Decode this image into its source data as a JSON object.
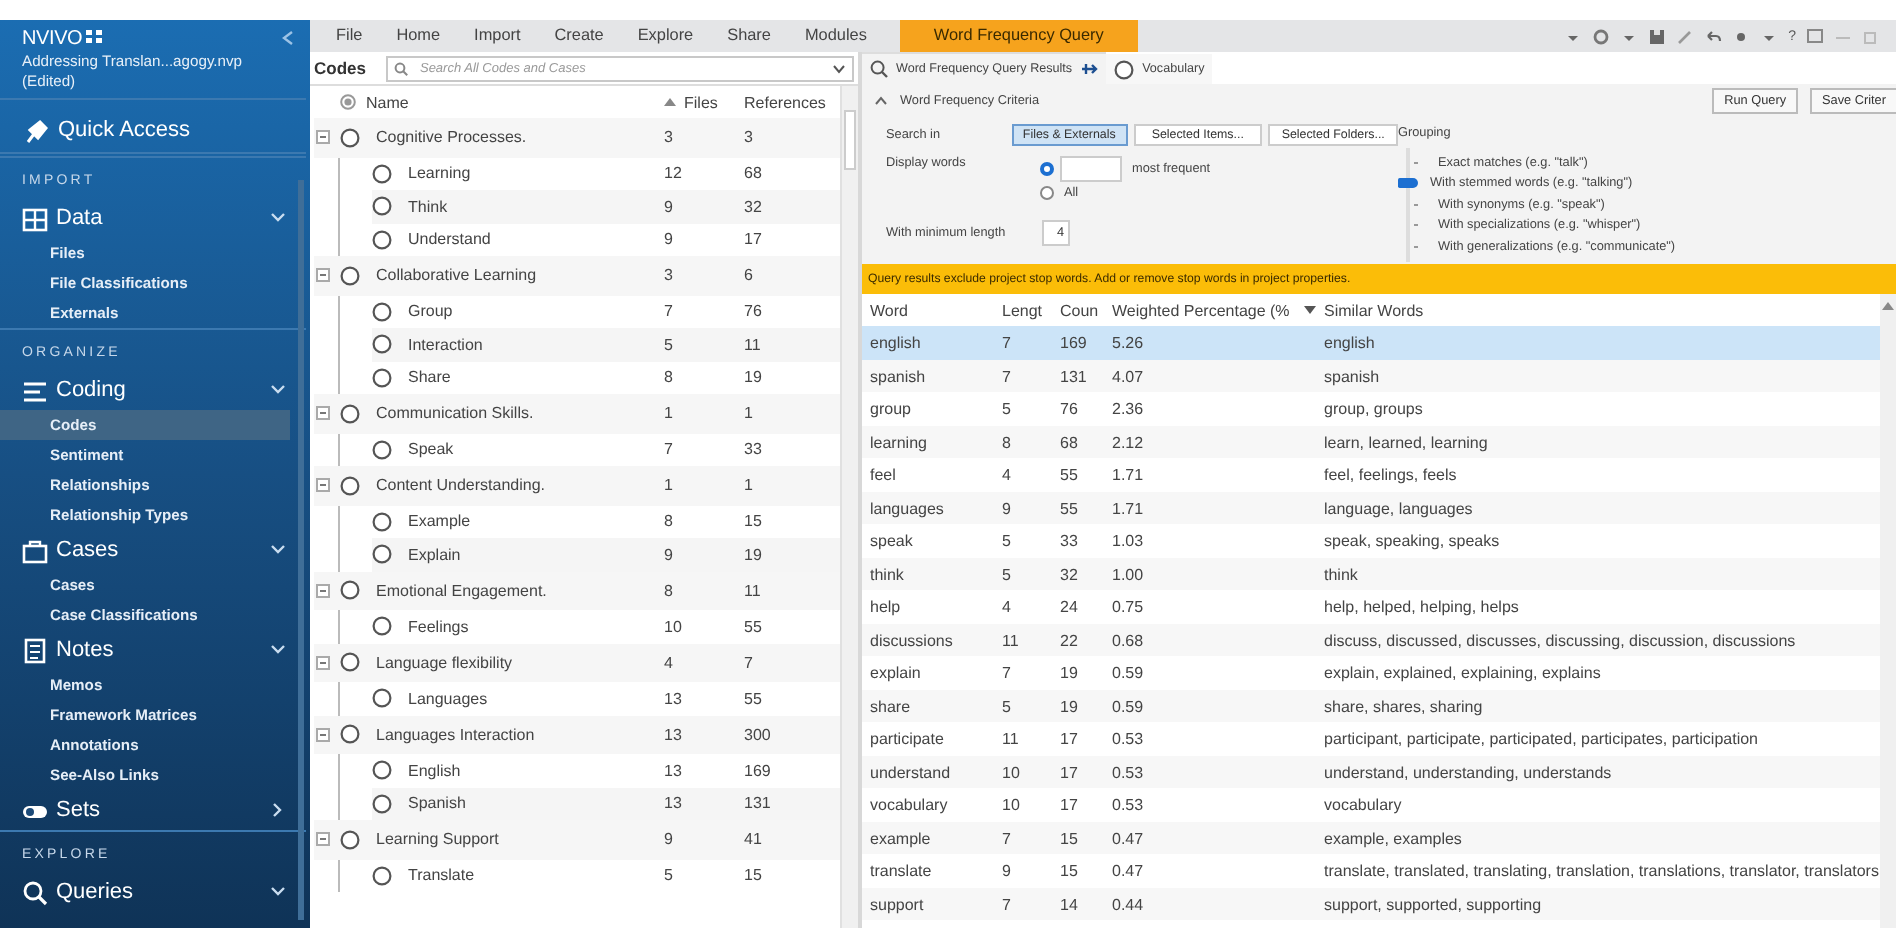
{
  "app": {
    "logo": "NVIVO",
    "project_file": "Addressing Translan...agogy.nvp",
    "project_state": "(Edited)"
  },
  "sidebar": [
    {
      "kind": "link",
      "label": "Quick Access"
    },
    {
      "kind": "heading",
      "label": "IMPORT"
    },
    {
      "kind": "group",
      "label": "Data",
      "expanded": true,
      "items": [
        {
          "label": "Files",
          "selected": false
        },
        {
          "label": "File Classifications",
          "selected": false
        },
        {
          "label": "Externals",
          "selected": false
        }
      ]
    },
    {
      "kind": "heading",
      "label": "ORGANIZE"
    },
    {
      "kind": "group",
      "label": "Coding",
      "expanded": true,
      "items": [
        {
          "label": "Codes",
          "selected": true
        },
        {
          "label": "Sentiment",
          "selected": false
        },
        {
          "label": "Relationships",
          "selected": false
        },
        {
          "label": "Relationship Types",
          "selected": false
        }
      ]
    },
    {
      "kind": "group",
      "label": "Cases",
      "expanded": true,
      "items": [
        {
          "label": "Cases",
          "selected": false
        },
        {
          "label": "Case Classifications",
          "selected": false
        }
      ]
    },
    {
      "kind": "group",
      "label": "Notes",
      "expanded": true,
      "items": [
        {
          "label": "Memos",
          "selected": false
        },
        {
          "label": "Framework Matrices",
          "selected": false
        },
        {
          "label": "Annotations",
          "selected": false
        },
        {
          "label": "See-Also Links",
          "selected": false
        }
      ]
    },
    {
      "kind": "group",
      "label": "Sets",
      "expanded": false
    },
    {
      "kind": "heading",
      "label": "EXPLORE"
    },
    {
      "kind": "group",
      "label": "Queries",
      "expanded": true
    }
  ],
  "menu": [
    {
      "label": "File",
      "selected": false
    },
    {
      "label": "Home",
      "selected": false
    },
    {
      "label": "Import",
      "selected": false
    },
    {
      "label": "Create",
      "selected": false
    },
    {
      "label": "Explore",
      "selected": false
    },
    {
      "label": "Share",
      "selected": false
    },
    {
      "label": "Modules",
      "selected": false
    },
    {
      "label": "Word Frequency Query",
      "selected": true
    }
  ],
  "toolbar": {
    "help": "?"
  },
  "codes": {
    "title": "Codes",
    "search": {
      "placeholder": "Search All Codes and Cases"
    },
    "columns": [
      "Name",
      "Files",
      "References"
    ],
    "rows": [
      {
        "name": "Cognitive Processes.",
        "files": "3",
        "references": "3",
        "expanded": true,
        "children": [
          {
            "name": "Learning",
            "files": "12",
            "references": "68"
          },
          {
            "name": "Think",
            "files": "9",
            "references": "32"
          },
          {
            "name": "Understand",
            "files": "9",
            "references": "17"
          }
        ]
      },
      {
        "name": "Collaborative Learning",
        "files": "3",
        "references": "6",
        "expanded": true,
        "children": [
          {
            "name": "Group",
            "files": "7",
            "references": "76"
          },
          {
            "name": "Interaction",
            "files": "5",
            "references": "11"
          },
          {
            "name": "Share",
            "files": "8",
            "references": "19"
          }
        ]
      },
      {
        "name": "Communication Skills.",
        "files": "1",
        "references": "1",
        "expanded": true,
        "children": [
          {
            "name": "Speak",
            "files": "7",
            "references": "33"
          }
        ]
      },
      {
        "name": "Content Understanding.",
        "files": "1",
        "references": "1",
        "expanded": true,
        "children": [
          {
            "name": "Example",
            "files": "8",
            "references": "15"
          },
          {
            "name": "Explain",
            "files": "9",
            "references": "19"
          }
        ]
      },
      {
        "name": "Emotional Engagement.",
        "files": "8",
        "references": "11",
        "expanded": true,
        "children": [
          {
            "name": "Feelings",
            "files": "10",
            "references": "55"
          }
        ]
      },
      {
        "name": "Language flexibility",
        "files": "4",
        "references": "7",
        "expanded": true,
        "children": [
          {
            "name": "Languages",
            "files": "13",
            "references": "55"
          }
        ]
      },
      {
        "name": "Languages Interaction",
        "files": "13",
        "references": "300",
        "expanded": true,
        "children": [
          {
            "name": "English",
            "files": "13",
            "references": "169"
          },
          {
            "name": "Spanish",
            "files": "13",
            "references": "131"
          }
        ]
      },
      {
        "name": "Learning Support",
        "files": "9",
        "references": "41",
        "expanded": true,
        "children": [
          {
            "name": "Translate",
            "files": "5",
            "references": "15"
          }
        ]
      }
    ]
  },
  "query": {
    "tabs": [
      {
        "label": "Word Frequency Query Results",
        "selected": true
      },
      {
        "label": "Vocabulary",
        "selected": false
      }
    ],
    "criteria_title": "Word Frequency Criteria",
    "buttons": [
      "Run Query",
      "Save Criter"
    ],
    "search_in": {
      "label": "Search in",
      "options": [
        {
          "label": "Files & Externals",
          "selected": true
        },
        {
          "label": "Selected Items...",
          "selected": false
        },
        {
          "label": "Selected Folders...",
          "selected": false
        }
      ]
    },
    "display_words": {
      "label": "Display words",
      "options": [
        {
          "kind": "count",
          "selected": true,
          "suffix": "most frequent"
        },
        {
          "kind": "all",
          "selected": false,
          "label": "All"
        }
      ]
    },
    "min_length": {
      "label": "With minimum length",
      "value": "4"
    },
    "grouping": {
      "label": "Grouping",
      "options": [
        {
          "label": "Exact matches (e.g. \"talk\")",
          "selected": false
        },
        {
          "label": "With stemmed words (e.g. \"talking\")",
          "selected": true
        },
        {
          "label": "With synonyms (e.g. \"speak\")",
          "selected": false
        },
        {
          "label": "With specializations (e.g. \"whisper\")",
          "selected": false
        },
        {
          "label": "With generalizations (e.g. \"communicate\")",
          "selected": false
        }
      ]
    },
    "notice": "Query results exclude project stop words. Add or remove stop words in project properties.",
    "results": {
      "columns": [
        "Word",
        "Lengt",
        "Coun",
        "Weighted Percentage (%",
        "Similar Words"
      ],
      "rows": [
        {
          "cells": [
            "english",
            "7",
            "169",
            "5.26",
            "english"
          ],
          "selected": true
        },
        {
          "cells": [
            "spanish",
            "7",
            "131",
            "4.07",
            "spanish"
          ],
          "selected": false
        },
        {
          "cells": [
            "group",
            "5",
            "76",
            "2.36",
            "group, groups"
          ],
          "selected": false
        },
        {
          "cells": [
            "learning",
            "8",
            "68",
            "2.12",
            "learn, learned, learning"
          ],
          "selected": false
        },
        {
          "cells": [
            "feel",
            "4",
            "55",
            "1.71",
            "feel, feelings, feels"
          ],
          "selected": false
        },
        {
          "cells": [
            "languages",
            "9",
            "55",
            "1.71",
            "language, languages"
          ],
          "selected": false
        },
        {
          "cells": [
            "speak",
            "5",
            "33",
            "1.03",
            "speak, speaking, speaks"
          ],
          "selected": false
        },
        {
          "cells": [
            "think",
            "5",
            "32",
            "1.00",
            "think"
          ],
          "selected": false
        },
        {
          "cells": [
            "help",
            "4",
            "24",
            "0.75",
            "help, helped, helping, helps"
          ],
          "selected": false
        },
        {
          "cells": [
            "discussions",
            "11",
            "22",
            "0.68",
            "discuss, discussed, discusses, discussing, discussion, discussions"
          ],
          "selected": false
        },
        {
          "cells": [
            "explain",
            "7",
            "19",
            "0.59",
            "explain, explained, explaining, explains"
          ],
          "selected": false
        },
        {
          "cells": [
            "share",
            "5",
            "19",
            "0.59",
            "share, shares, sharing"
          ],
          "selected": false
        },
        {
          "cells": [
            "participate",
            "11",
            "17",
            "0.53",
            "participant, participate, participated, participates, participation"
          ],
          "selected": false
        },
        {
          "cells": [
            "understand",
            "10",
            "17",
            "0.53",
            "understand, understanding, understands"
          ],
          "selected": false
        },
        {
          "cells": [
            "vocabulary",
            "10",
            "17",
            "0.53",
            "vocabulary"
          ],
          "selected": false
        },
        {
          "cells": [
            "example",
            "7",
            "15",
            "0.47",
            "example, examples"
          ],
          "selected": false
        },
        {
          "cells": [
            "translate",
            "9",
            "15",
            "0.47",
            "translate, translated, translating, translation, translations, translator, translators"
          ],
          "selected": false
        },
        {
          "cells": [
            "support",
            "7",
            "14",
            "0.44",
            "support, supported, supporting"
          ],
          "selected": false
        }
      ]
    }
  }
}
